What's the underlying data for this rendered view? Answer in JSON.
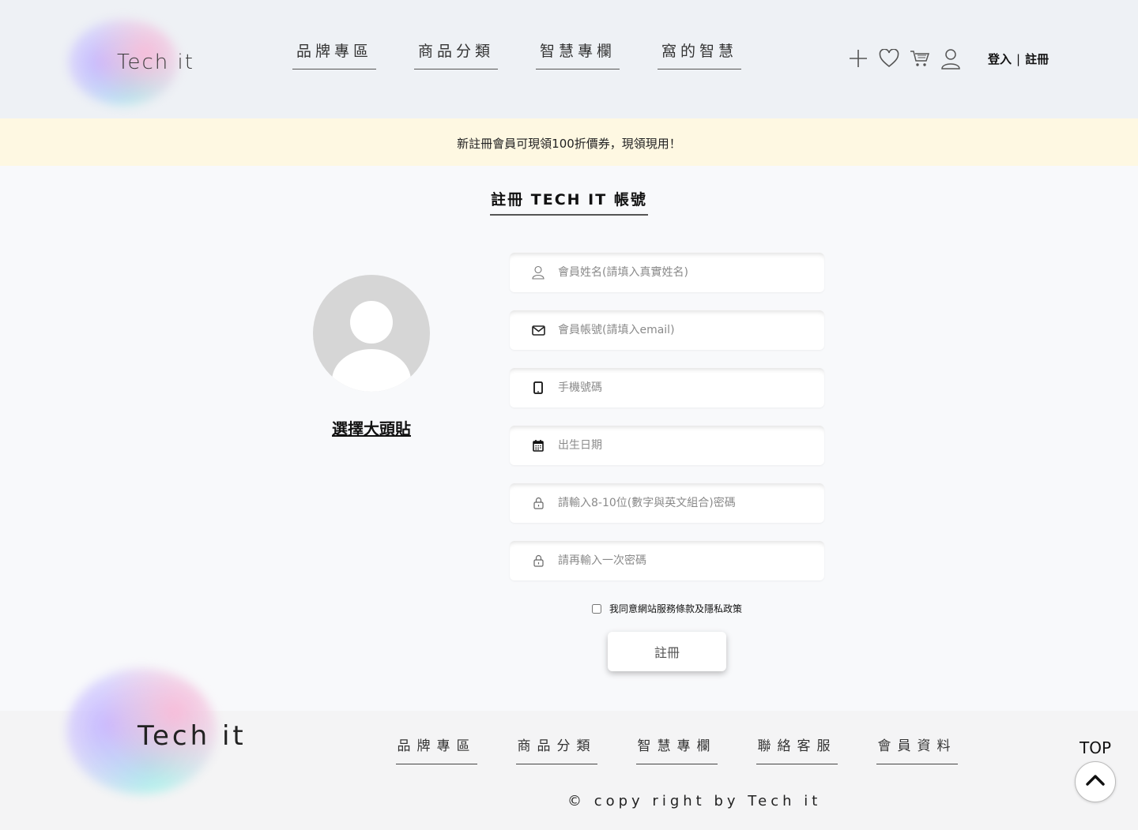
{
  "header": {
    "logo_text": "Tech it",
    "nav": [
      "品牌專區",
      "商品分類",
      "智慧專欄",
      "窩的智慧"
    ],
    "icons": [
      "plus-icon",
      "heart-icon",
      "cart-icon",
      "user-icon"
    ],
    "login": "登入",
    "separator": "|",
    "register": "註冊"
  },
  "promo": "新註冊會員可現領100折價券，現領現用！",
  "page_title": "註冊 TECH IT 帳號",
  "avatar": {
    "link": "選擇大頭貼"
  },
  "form": {
    "fields": [
      {
        "icon": "user-icon",
        "placeholder": "會員姓名(請填入真實姓名)",
        "value": ""
      },
      {
        "icon": "envelope-icon",
        "placeholder": "會員帳號(請填入email)",
        "value": ""
      },
      {
        "icon": "phone-icon",
        "placeholder": "手機號碼",
        "value": ""
      },
      {
        "icon": "calendar-icon",
        "placeholder": "出生日期",
        "value": ""
      },
      {
        "icon": "lock-icon",
        "placeholder": "請輸入8-10位(數字與英文組合)密碼",
        "value": ""
      },
      {
        "icon": "lock-icon",
        "placeholder": "請再輸入一次密碼",
        "value": ""
      }
    ],
    "agree": "我同意網站服務條款及隱私政策",
    "submit": "註冊"
  },
  "footer": {
    "logo_text": "Tech it",
    "nav": [
      "品牌專區",
      "商品分類",
      "智慧專欄",
      "聯絡客服",
      "會員資料"
    ],
    "copyright": "© copy right by Tech it",
    "top_label": "TOP"
  }
}
